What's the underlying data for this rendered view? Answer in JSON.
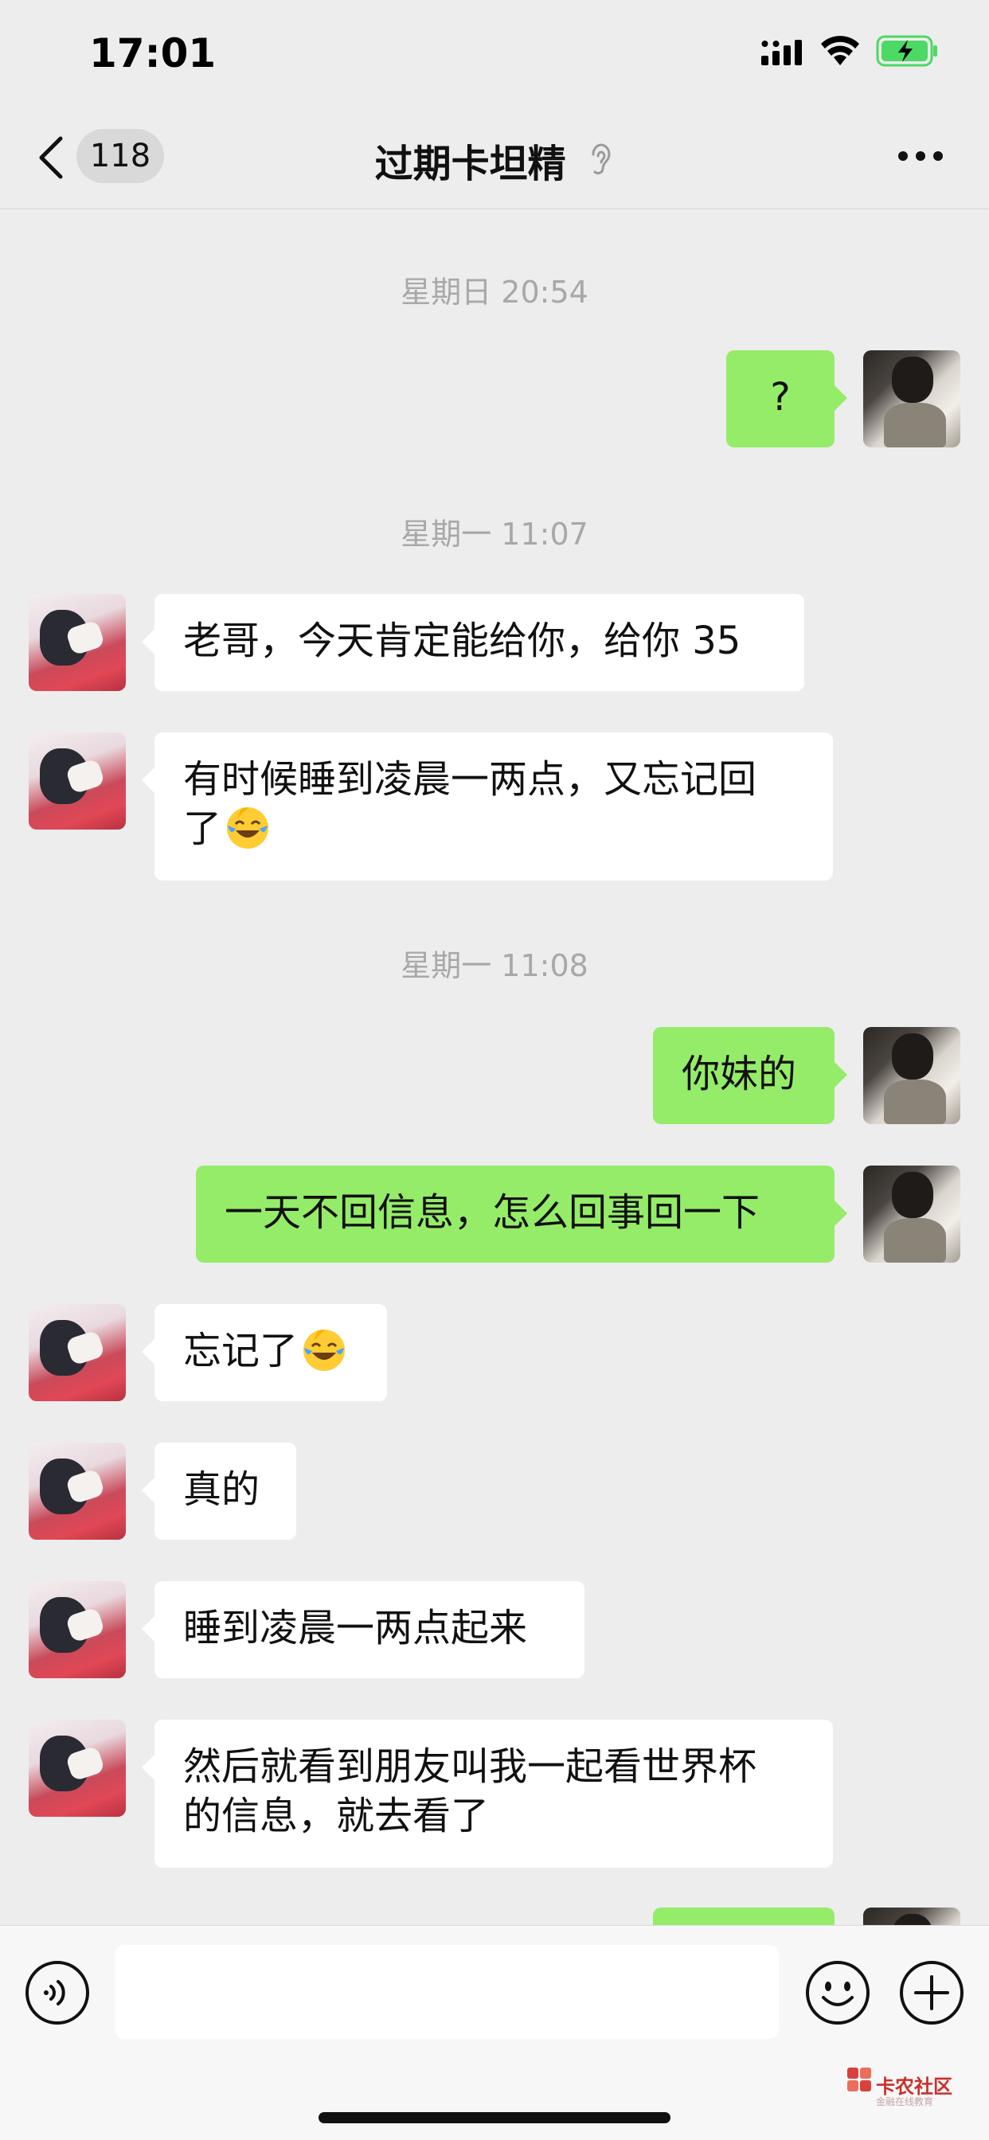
{
  "status_bar": {
    "time": "17:01"
  },
  "nav": {
    "unread_count": "118",
    "title": "过期卡坦精"
  },
  "messages": [
    {
      "type": "timestamp",
      "text": "星期日 20:54"
    },
    {
      "type": "self",
      "text": "?"
    },
    {
      "type": "timestamp",
      "text": "星期一 11:07"
    },
    {
      "type": "other",
      "text": "老哥，今天肯定能给你，给你 35"
    },
    {
      "type": "other",
      "line1": "有时候睡到凌晨一两点，又忘记回",
      "line2": "了",
      "emoji": "face-with-tears-of-joy"
    },
    {
      "type": "timestamp",
      "text": "星期一 11:08"
    },
    {
      "type": "self",
      "text": "你妹的"
    },
    {
      "type": "self",
      "text": "一天不回信息，怎么回事回一下"
    },
    {
      "type": "other",
      "text": "忘记了",
      "emoji": "face-with-tears-of-joy"
    },
    {
      "type": "other",
      "text": "真的"
    },
    {
      "type": "other",
      "text": "睡到凌晨一两点起来"
    },
    {
      "type": "other",
      "line1": "然后就看到朋友叫我一起看世界杯",
      "line2": "的信息，就去看了"
    },
    {
      "type": "self",
      "text": ""
    }
  ],
  "input": {
    "placeholder": ""
  },
  "watermark": {
    "name": "卡农社区",
    "sub": "金融在线教育"
  },
  "colors": {
    "background": "#ededed",
    "self_bubble": "#95ec69",
    "other_bubble": "#ffffff",
    "timestamp": "#a8a8a8",
    "battery": "#4cd964"
  }
}
